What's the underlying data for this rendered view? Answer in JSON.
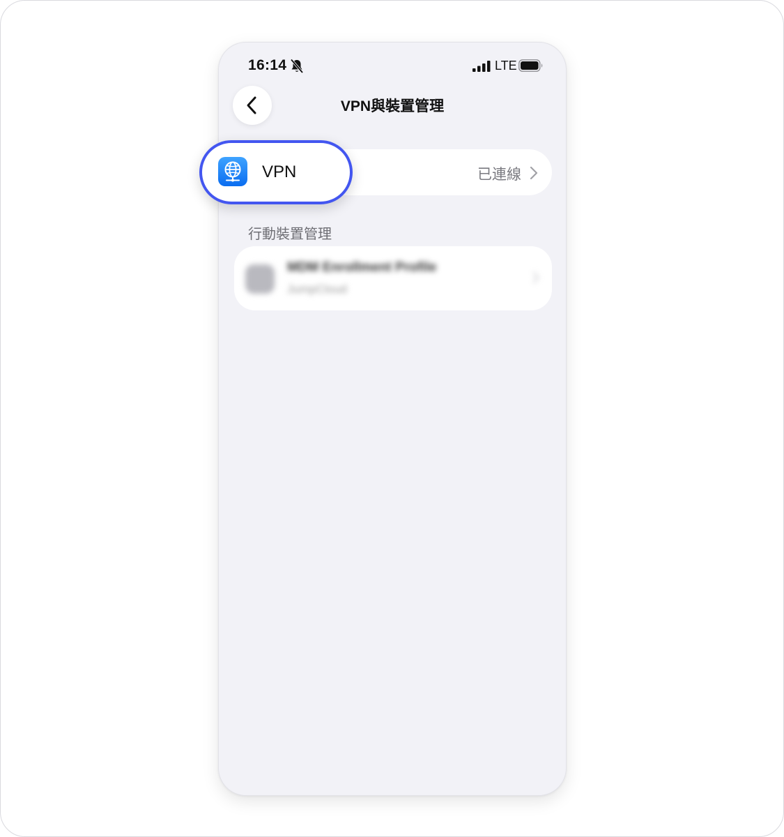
{
  "status_bar": {
    "time": "16:14",
    "network": "LTE",
    "icons": [
      "bell-slash-icon",
      "signal-icon",
      "battery-icon"
    ]
  },
  "nav": {
    "back_icon": "chevron-left-icon",
    "title": "VPN與裝置管理"
  },
  "vpn_row": {
    "icon": "globe-network-icon",
    "label": "VPN",
    "status": "已連線",
    "chevron": "chevron-right-icon"
  },
  "device_section": {
    "header": "行動裝置管理",
    "items": [
      {
        "title": "MDM Enrollment Profile",
        "subtitle": "JumpCloud",
        "blurred": true
      }
    ]
  },
  "colors": {
    "highlight_ring": "#4356f0",
    "screen_background": "#f2f2f7",
    "card_background": "#ffffff",
    "vpn_icon_blue": "#0a6df0",
    "secondary_text": "#7a7a80"
  }
}
